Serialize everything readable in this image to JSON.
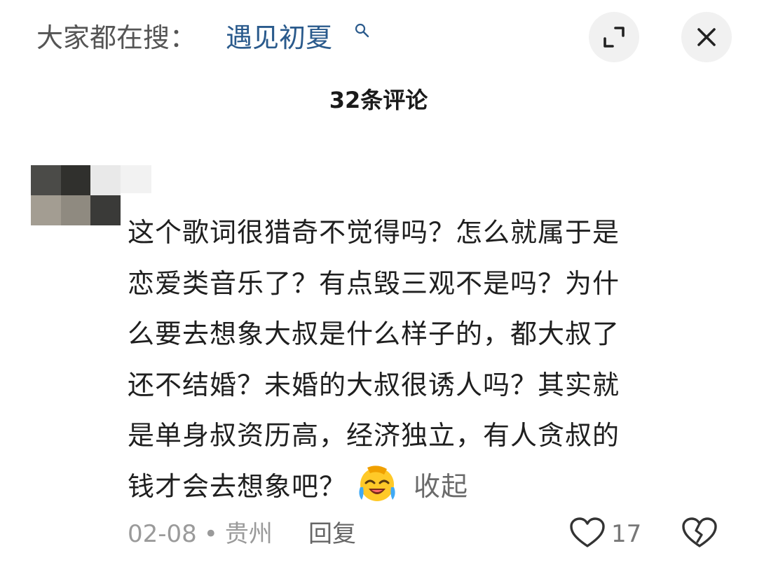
{
  "search": {
    "prefix": "大家都在搜：",
    "term": "遇见初夏"
  },
  "header": {
    "comment_count_title": "32条评论"
  },
  "comment": {
    "lines": [
      "这个歌词很猎奇不觉得吗？怎么就属于是",
      "恋爱类音乐了？有点毁三观不是吗？为什",
      "么要去想象大叔是什么样子的，都大叔了",
      "还不结婚？未婚的大叔很诱人吗？其实就",
      "是单身叔资历高，经济独立，有人贪叔的",
      "钱才会去想象吧？"
    ],
    "collapse_label": "收起",
    "emoji": "laughing-crying-emoji"
  },
  "footer": {
    "date": "02-08",
    "separator": "•",
    "location": "贵州",
    "reply_label": "回复",
    "like_count": "17"
  },
  "icons": {
    "search": "search-icon",
    "expand": "expand-icon",
    "close": "close-icon",
    "like": "heart-icon",
    "dislike": "broken-heart-icon"
  },
  "colors": {
    "search_term": "#2a5a8c",
    "muted": "#9a9a9a",
    "button_bg": "#f1f1f1"
  }
}
